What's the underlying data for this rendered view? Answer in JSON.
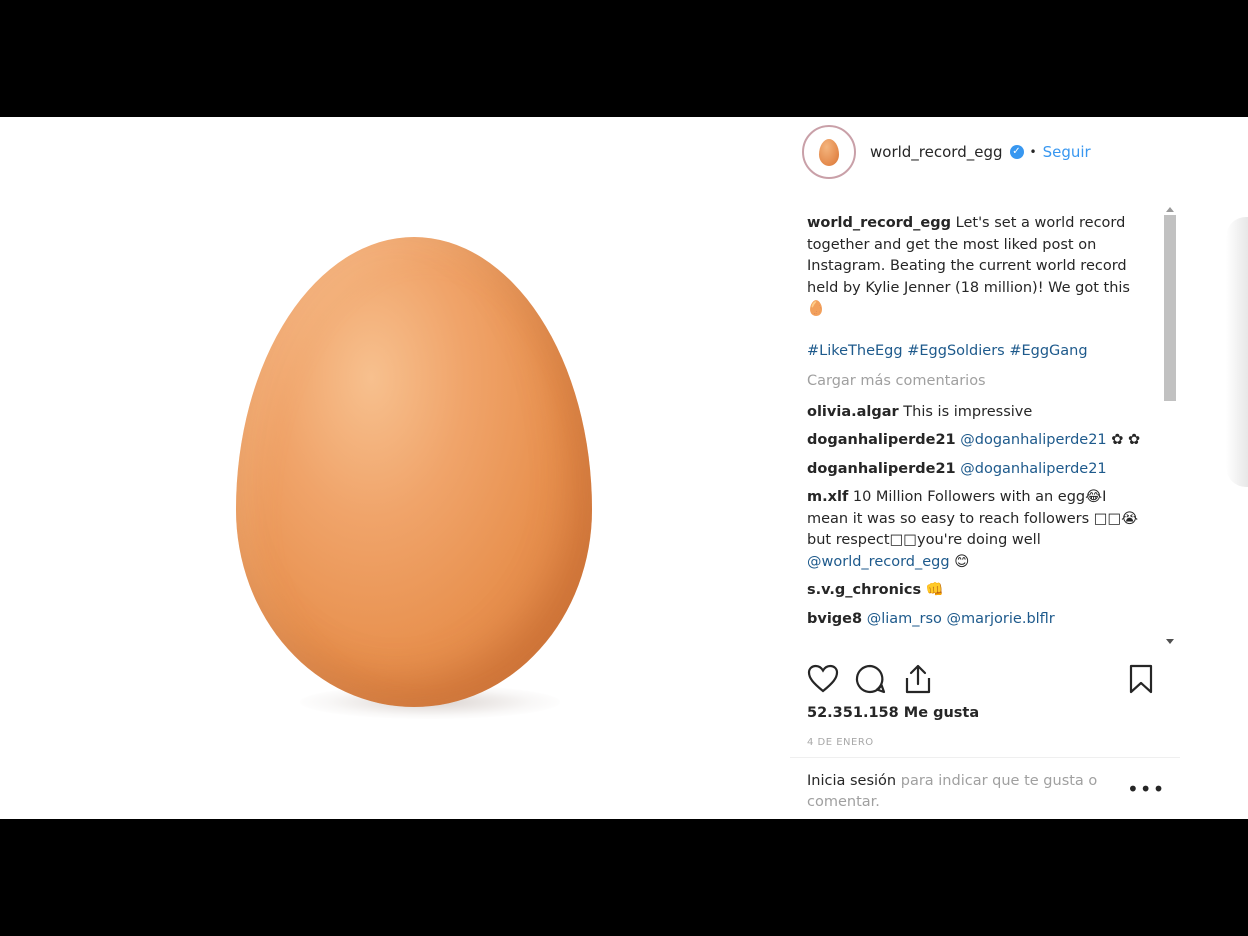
{
  "header": {
    "username": "world_record_egg",
    "verified_mark": "✓",
    "separator": "•",
    "follow_label": "Seguir"
  },
  "caption": {
    "username": "world_record_egg",
    "text": "Let's set a world record together and get the most liked post on Instagram. Beating the current world record held by Kylie Jenner (18 million)! We got this 🥚",
    "hashtags": [
      "#LikeTheEgg",
      "#EggSoldiers",
      "#EggGang"
    ]
  },
  "load_more_label": "Cargar más comentarios",
  "comments": [
    {
      "user": "olivia.algar",
      "text": "This is impressive"
    },
    {
      "user": "doganhaliperde21",
      "mention": "@doganhaliperde21",
      "text": "✿ ✿"
    },
    {
      "user": "doganhaliperde21",
      "mention": "@doganhaliperde21",
      "text": ""
    },
    {
      "user": "m.xlf",
      "text": "10 Million Followers with an egg😂I mean it was so easy to reach followers □□😭but respect□□you're doing well",
      "mention_after": "@world_record_egg",
      "tail": "😊"
    },
    {
      "user": "s.v.g_chronics",
      "text": "👊"
    },
    {
      "user": "bvige8",
      "mention": "@liam_rso",
      "mention2": "@marjorie.blflr"
    }
  ],
  "likes_text": "52.351.158 Me gusta",
  "date_text": "4 DE ENERO",
  "login": {
    "action": "Inicia sesión",
    "rest": "para indicar que te gusta o comentar."
  },
  "more_options": "•••",
  "icons": [
    "heart-icon",
    "comment-icon",
    "share-icon",
    "bookmark-icon"
  ],
  "colors": {
    "link": "#3897f0",
    "mention": "#1e5a8c",
    "egg": "#e8914f"
  }
}
